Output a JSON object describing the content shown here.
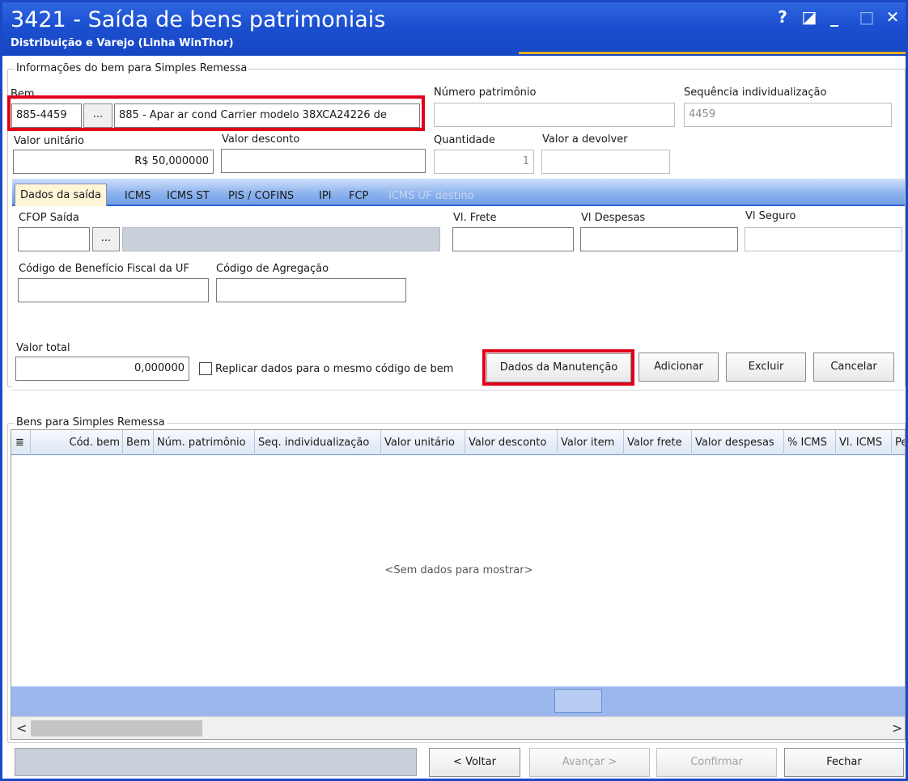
{
  "window": {
    "title": "3421 - Saída de bens patrimoniais",
    "subtitle": "Distribuição e Varejo (Linha WinThor)",
    "controls": {
      "help": "?",
      "restore": "◪",
      "minimize": "_",
      "maximize": "□",
      "close": "✕"
    }
  },
  "info_group": {
    "title": "Informações do bem para Simples Remessa",
    "bem_label": "Bem",
    "bem_code": "885-4459",
    "bem_button": "...",
    "bem_description": "885 - Apar ar cond Carrier modelo 38XCA24226 de",
    "numero_patrimonio_label": "Número patrimônio",
    "numero_patrimonio_value": "",
    "sequencia_label": "Sequência individualização",
    "sequencia_value": "4459",
    "valor_unitario_label": "Valor unitário",
    "valor_unitario_value": "R$ 50,000000",
    "valor_desconto_label": "Valor desconto",
    "valor_desconto_value": "",
    "quantidade_label": "Quantidade",
    "quantidade_value": "1",
    "valor_devolver_label": "Valor a devolver",
    "valor_devolver_value": ""
  },
  "tabs": [
    {
      "label": "Dados da saída",
      "state": "active"
    },
    {
      "label": "ICMS",
      "state": "normal"
    },
    {
      "label": "ICMS ST",
      "state": "normal"
    },
    {
      "label": "PIS / COFINS",
      "state": "normal"
    },
    {
      "label": "IPI",
      "state": "normal"
    },
    {
      "label": "FCP",
      "state": "normal"
    },
    {
      "label": "ICMS UF destino",
      "state": "disabled"
    }
  ],
  "dados_saida": {
    "cfop_label": "CFOP Saída",
    "cfop_value": "",
    "cfop_button": "...",
    "cfop_description": "",
    "vl_frete_label": "Vl. Frete",
    "vl_frete_value": "",
    "vl_despesas_label": "Vl Despesas",
    "vl_despesas_value": "",
    "vl_seguro_label": "Vl Seguro",
    "vl_seguro_value": "",
    "cod_beneficio_label": "Código de Benefício Fiscal da UF",
    "cod_beneficio_value": "",
    "cod_agregacao_label": "Código de Agregação",
    "cod_agregacao_value": "",
    "valor_total_label": "Valor total",
    "valor_total_value": "0,000000",
    "replicar_label": "Replicar dados para o mesmo código de bem",
    "replicar_checked": false,
    "buttons": {
      "dados_manutencao": "Dados da Manutenção",
      "adicionar": "Adicionar",
      "excluir": "Excluir",
      "cancelar": "Cancelar"
    }
  },
  "bens_group": {
    "title": "Bens para Simples Remessa",
    "columns": [
      "Cód. bem",
      "Bem",
      "Núm. patrimônio",
      "Seq. individualização",
      "Valor unitário",
      "Valor desconto",
      "Valor item",
      "Valor frete",
      "Valor despesas",
      "% ICMS",
      "Vl. ICMS",
      "Pe"
    ],
    "empty_text": "<Sem dados para mostrar>",
    "scroll_left": "<",
    "scroll_right": ">"
  },
  "footer": {
    "voltar": "< Voltar",
    "avancar": "Avançar >",
    "confirmar": "Confirmar",
    "fechar": "Fechar"
  },
  "colors": {
    "title_bar": "#1b4fd0",
    "highlight": "#e0001a",
    "tab_active": "#fff6d8",
    "grid_footer": "#9bb7ec"
  }
}
